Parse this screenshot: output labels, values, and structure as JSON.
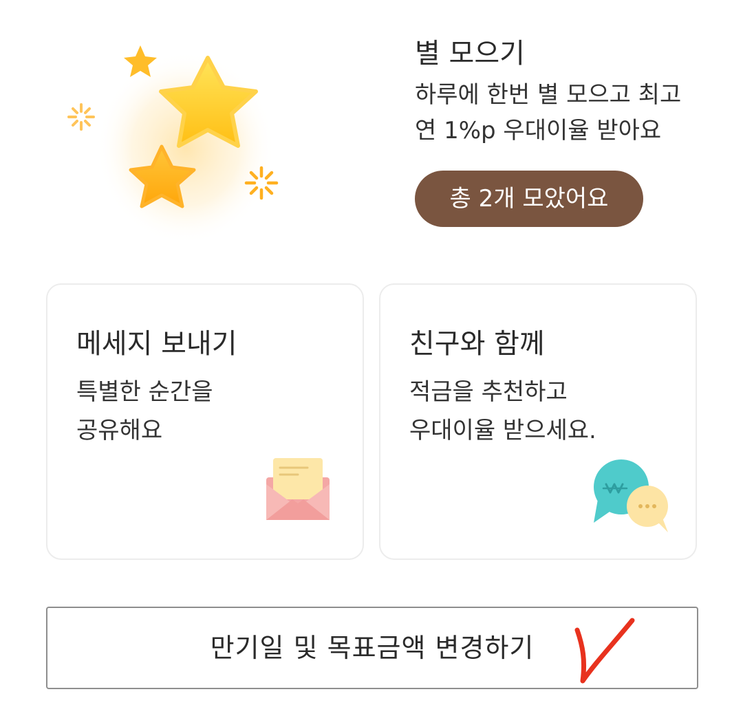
{
  "star_collect": {
    "title": "별 모으기",
    "description": "하루에 한번 별 모으고 최고\n연 1%p 우대이율 받아요",
    "collected_label": "총 2개 모았어요",
    "art_icon": "stars-icon"
  },
  "cards": [
    {
      "title": "메세지 보내기",
      "description": "특별한 순간을\n공유해요",
      "icon": "envelope-icon"
    },
    {
      "title": "친구와 함께",
      "description": "적금을 추천하고\n우대이율 받으세요.",
      "icon": "chat-bubbles-icon"
    }
  ],
  "change_button": {
    "label": "만기일 및 목표금액 변경하기",
    "annotation_icon": "red-checkmark-icon"
  },
  "colors": {
    "pill_bg": "#7a5540",
    "star_gold": "#ffc928",
    "envelope_pink": "#f3a3a3",
    "chat_teal": "#4cc9c9",
    "annotation_red": "#e8321e"
  }
}
